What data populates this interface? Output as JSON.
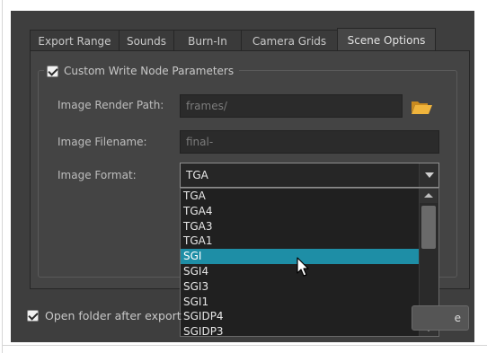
{
  "tabs": [
    {
      "label": "Export Range",
      "active": false
    },
    {
      "label": "Sounds",
      "active": false
    },
    {
      "label": "Burn-In",
      "active": false
    },
    {
      "label": "Camera Grids",
      "active": false
    },
    {
      "label": "Scene Options",
      "active": true
    }
  ],
  "group": {
    "title": "Custom Write Node Parameters",
    "checked": true
  },
  "fields": {
    "render_path": {
      "label": "Image Render Path:",
      "value": "frames/"
    },
    "filename": {
      "label": "Image Filename:",
      "value": "final-"
    },
    "format": {
      "label": "Image Format:",
      "value": "TGA"
    }
  },
  "dropdown": {
    "options": [
      "TGA",
      "TGA4",
      "TGA3",
      "TGA1",
      "SGI",
      "SGI4",
      "SGI3",
      "SGI1",
      "SGIDP4",
      "SGIDP3"
    ],
    "highlighted": "SGI"
  },
  "bottom": {
    "open_folder_label": "Open folder after export",
    "open_folder_checked": true,
    "button_label_visible": "e"
  },
  "icons": {
    "folder": "folder-icon",
    "cursor": "mouse-pointer-icon"
  },
  "colors": {
    "highlight": "#1e8ea6",
    "folder": "#f0b43c"
  }
}
